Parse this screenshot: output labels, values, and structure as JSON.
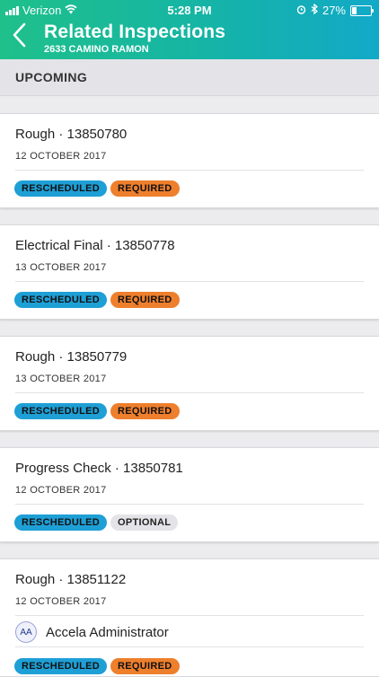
{
  "status_bar": {
    "carrier": "Verizon",
    "time": "5:28 PM",
    "battery": "27%",
    "battery_level": 0.27
  },
  "nav": {
    "title": "Related Inspections",
    "subtitle": "2633 CAMINO RAMON",
    "back_icon": "chevron-left-icon"
  },
  "section": {
    "label": "UPCOMING"
  },
  "inspections": [
    {
      "title": "Rough · 13850780",
      "date": "12 OCTOBER 2017",
      "badges": [
        {
          "label": "RESCHEDULED",
          "kind": "resched"
        },
        {
          "label": "REQUIRED",
          "kind": "required"
        }
      ]
    },
    {
      "title": "Electrical Final · 13850778",
      "date": "13 OCTOBER 2017",
      "badges": [
        {
          "label": "RESCHEDULED",
          "kind": "resched"
        },
        {
          "label": "REQUIRED",
          "kind": "required"
        }
      ]
    },
    {
      "title": "Rough · 13850779",
      "date": "13 OCTOBER 2017",
      "badges": [
        {
          "label": "RESCHEDULED",
          "kind": "resched"
        },
        {
          "label": "REQUIRED",
          "kind": "required"
        }
      ]
    },
    {
      "title": "Progress Check · 13850781",
      "date": "12 OCTOBER 2017",
      "badges": [
        {
          "label": "RESCHEDULED",
          "kind": "resched"
        },
        {
          "label": "OPTIONAL",
          "kind": "optional"
        }
      ]
    },
    {
      "title": "Rough · 13851122",
      "date": "12 OCTOBER 2017",
      "assignee": {
        "initials": "AA",
        "name": "Accela Administrator"
      },
      "badges": [
        {
          "label": "RESCHEDULED",
          "kind": "resched"
        },
        {
          "label": "REQUIRED",
          "kind": "required"
        }
      ]
    }
  ],
  "colors": {
    "header_gradient_start": "#1fc08a",
    "header_gradient_end": "#12a9c8",
    "rescheduled": "#1e9fd6",
    "required": "#ee7f2d",
    "optional": "#e4e4e8"
  }
}
